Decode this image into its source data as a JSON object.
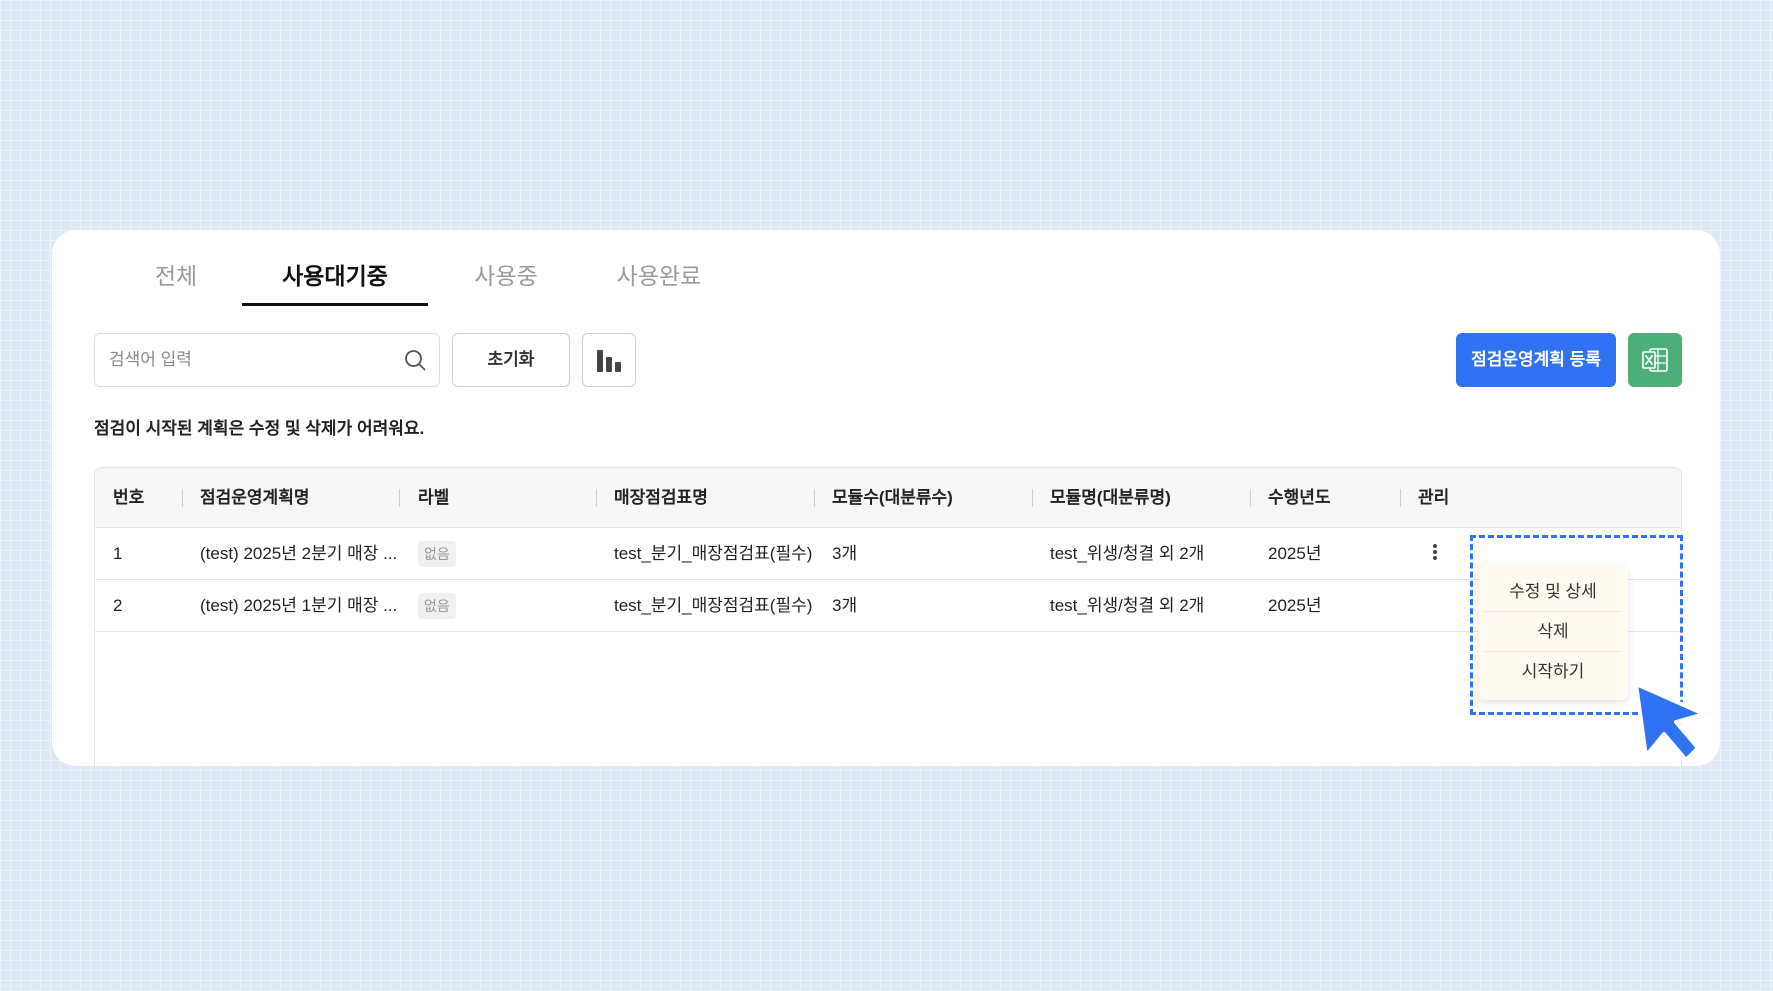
{
  "tabs": [
    {
      "label": "전체",
      "active": false
    },
    {
      "label": "사용대기중",
      "active": true
    },
    {
      "label": "사용중",
      "active": false
    },
    {
      "label": "사용완료",
      "active": false
    }
  ],
  "search": {
    "placeholder": "검색어 입력",
    "value": ""
  },
  "toolbar": {
    "reset_label": "초기화",
    "chart_icon": "bar-chart-icon",
    "register_label": "점검운영계획 등록",
    "excel_icon": "excel-icon"
  },
  "notice": "점검이 시작된 계획은 수정 및 삭제가 어려워요.",
  "table": {
    "headers": [
      "번호",
      "점검운영계획명",
      "라벨",
      "매장점검표명",
      "모듈수(대분류수)",
      "모듈명(대분류명)",
      "수행년도",
      "관리"
    ],
    "rows": [
      {
        "no": "1",
        "plan": "(test) 2025년 2분기 매장 ...",
        "label": "없음",
        "checklist": "test_분기_매장점검표(필수)",
        "modules": "3개",
        "module_names": "test_위생/청결 외 2개",
        "year": "2025년"
      },
      {
        "no": "2",
        "plan": "(test) 2025년 1분기 매장 ...",
        "label": "없음",
        "checklist": "test_분기_매장점검표(필수)",
        "modules": "3개",
        "module_names": "test_위생/청결 외 2개",
        "year": "2025년"
      }
    ]
  },
  "menu": {
    "items": [
      "수정 및 상세",
      "삭제",
      "시작하기"
    ]
  },
  "colors": {
    "primary": "#2f73f2",
    "excel": "#4caf78",
    "background": "#dde9f7",
    "menu_bg": "#fffaf0"
  }
}
